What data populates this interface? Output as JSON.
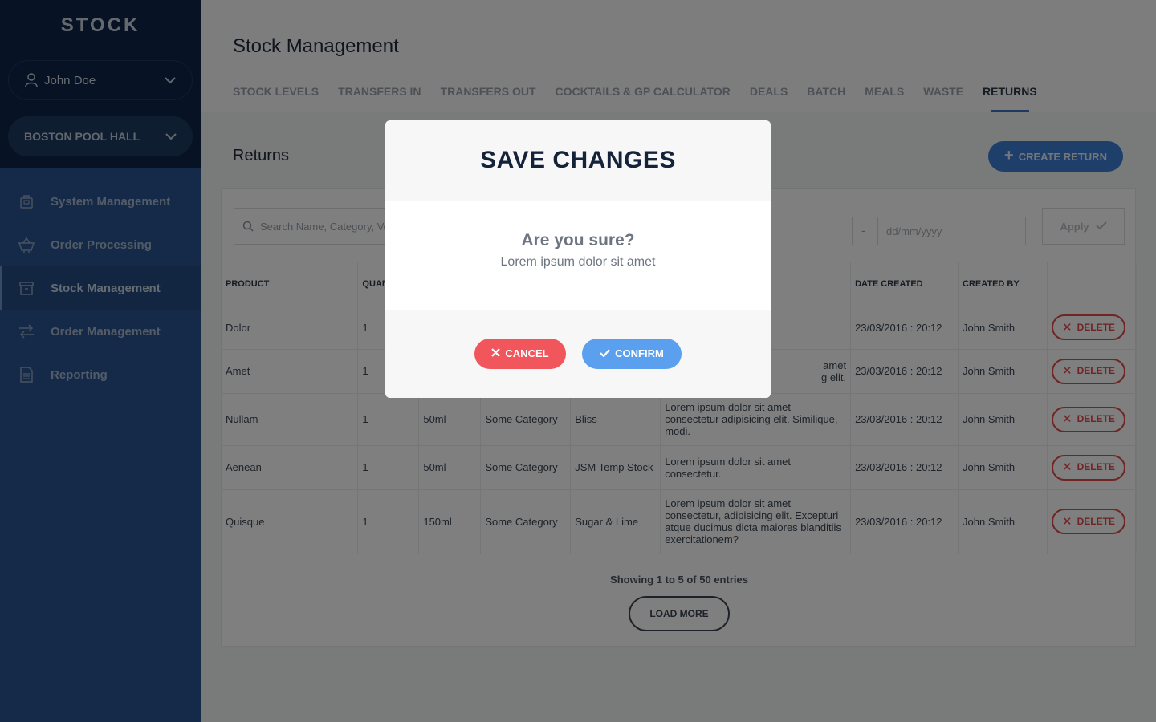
{
  "sidebar": {
    "brand": "STOCK",
    "user": "John Doe",
    "venue": "BOSTON POOL HALL",
    "items": [
      {
        "label": "System Management",
        "icon": "bag-icon"
      },
      {
        "label": "Order Processing",
        "icon": "basket-icon"
      },
      {
        "label": "Stock Management",
        "icon": "archive-icon",
        "active": true
      },
      {
        "label": "Order Management",
        "icon": "arrows-icon"
      },
      {
        "label": "Reporting",
        "icon": "document-icon"
      }
    ]
  },
  "header": {
    "title": "Stock Management",
    "tabs": [
      "STOCK LEVELS",
      "TRANSFERS IN",
      "TRANSFERS OUT",
      "COCKTAILS & GP CALCULATOR",
      "DEALS",
      "BATCH",
      "MEALS",
      "WASTE",
      "RETURNS"
    ],
    "active_tab": "RETURNS"
  },
  "returns": {
    "title": "Returns",
    "create_label": "CREATE RETURN",
    "search_placeholder": "Search Name, Category, Vo",
    "date_separator": "-",
    "date_placeholder": "dd/mm/yyyy",
    "apply_label": "Apply",
    "columns": [
      "PRODUCT",
      "QUAN",
      "",
      "",
      "",
      "",
      "DATE CREATED",
      "CREATED BY",
      ""
    ],
    "rows": [
      {
        "product": "Dolor",
        "qty": "1",
        "size": "",
        "category": "",
        "supplier": "",
        "notes": "",
        "date": "23/03/2016 : 20:12",
        "by": "John Smith"
      },
      {
        "product": "Amet",
        "qty": "1",
        "size": "",
        "category": "",
        "supplier": "",
        "notes": "amet\ng elit.",
        "date": "23/03/2016 : 20:12",
        "by": "John Smith"
      },
      {
        "product": "Nullam",
        "qty": "1",
        "size": "50ml",
        "category": "Some Category",
        "supplier": "Bliss",
        "notes": "Lorem ipsum dolor sit amet consectetur adipisicing elit. Similique, modi.",
        "date": "23/03/2016 : 20:12",
        "by": "John Smith"
      },
      {
        "product": "Aenean",
        "qty": "1",
        "size": "50ml",
        "category": "Some Category",
        "supplier": "JSM Temp Stock",
        "notes": "Lorem ipsum dolor sit amet consectetur.",
        "date": "23/03/2016 : 20:12",
        "by": "John Smith"
      },
      {
        "product": "Quisque",
        "qty": "1",
        "size": "150ml",
        "category": "Some Category",
        "supplier": "Sugar & Lime",
        "notes": "Lorem ipsum dolor sit amet consectetur, adipisicing elit. Excepturi atque ducimus dicta maiores blanditiis exercitationem?",
        "date": "23/03/2016 : 20:12",
        "by": "John Smith"
      }
    ],
    "delete_label": "DELETE",
    "info": "Showing 1 to 5 of 50 entries",
    "load_more": "LOAD MORE"
  },
  "modal": {
    "title": "SAVE CHANGES",
    "question": "Are you sure?",
    "subtitle": "Lorem ipsum dolor sit amet",
    "cancel_label": "CANCEL",
    "confirm_label": "CONFIRM"
  },
  "colors": {
    "sidebar_top": "#0f2748",
    "sidebar": "#2a5590",
    "accent": "#3d7ed4",
    "danger": "#f0565b",
    "confirm": "#5aa0ef"
  }
}
